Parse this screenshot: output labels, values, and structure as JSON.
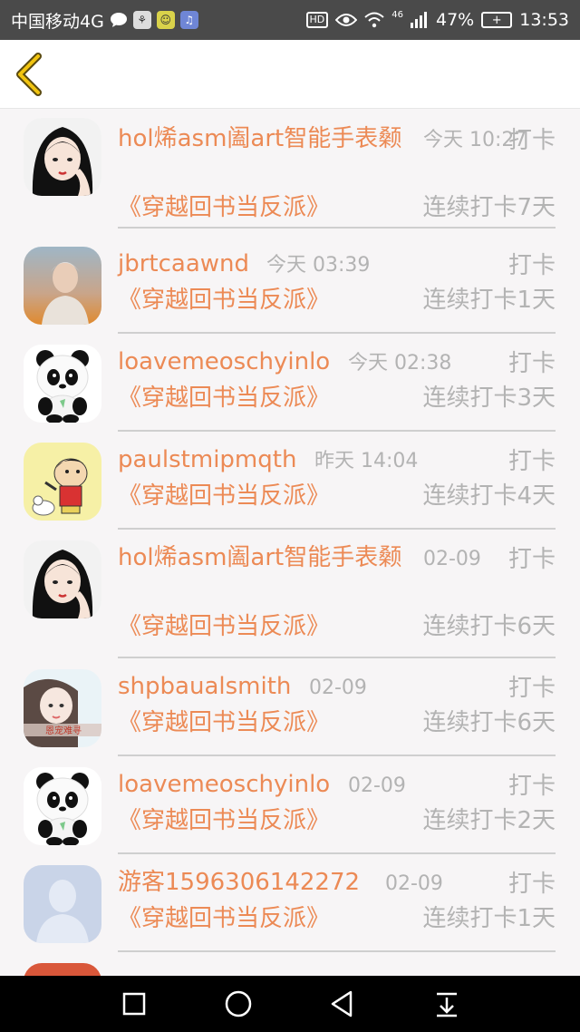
{
  "status_bar": {
    "carrier": "中国移动4G",
    "hd": "HD",
    "signal": "46",
    "battery_percent": "47%",
    "time": "13:53"
  },
  "header": {
    "back_icon": "chevron-left-icon",
    "accent": "#f1c40f"
  },
  "colors": {
    "name": "#ec8a55",
    "meta": "#b3b3b3",
    "divider": "#cfcfcf"
  },
  "items": [
    {
      "name": "hol烯asm阖art智能手表颡",
      "time": "今天 10:27",
      "action": "打卡",
      "book": "《穿越回书当反派》",
      "streak": "连续打卡7天",
      "avatar": "girl-portrait"
    },
    {
      "name": "jbrtcaawnd",
      "time": "今天 03:39",
      "action": "打卡",
      "book": "《穿越回书当反派》",
      "streak": "连续打卡1天",
      "avatar": "boy-photo"
    },
    {
      "name": "loavemeoschyinlo",
      "time": "今天 02:38",
      "action": "打卡",
      "book": "《穿越回书当反派》",
      "streak": "连续打卡3天",
      "avatar": "panda"
    },
    {
      "name": "paulstmipmqth",
      "time": "昨天 14:04",
      "action": "打卡",
      "book": "《穿越回书当反派》",
      "streak": "连续打卡4天",
      "avatar": "crayon-kid"
    },
    {
      "name": "hol烯asm阖art智能手表颡",
      "time": "02-09",
      "action": "打卡",
      "book": "《穿越回书当反派》",
      "streak": "连续打卡6天",
      "avatar": "girl-portrait"
    },
    {
      "name": "shpbaualsmith",
      "time": "02-09",
      "action": "打卡",
      "book": "《穿越回书当反派》",
      "streak": "连续打卡6天",
      "avatar": "girl-photo"
    },
    {
      "name": "loavemeoschyinlo",
      "time": "02-09",
      "action": "打卡",
      "book": "《穿越回书当反派》",
      "streak": "连续打卡2天",
      "avatar": "panda"
    },
    {
      "name": "游客1596306142272",
      "time": "02-09",
      "action": "打卡",
      "book": "《穿越回书当反派》",
      "streak": "连续打卡1天",
      "avatar": "default-user"
    }
  ],
  "nav": {
    "recent_icon": "square-icon",
    "home_icon": "circle-icon",
    "back_icon": "triangle-back-icon",
    "notif_icon": "pull-down-icon"
  }
}
